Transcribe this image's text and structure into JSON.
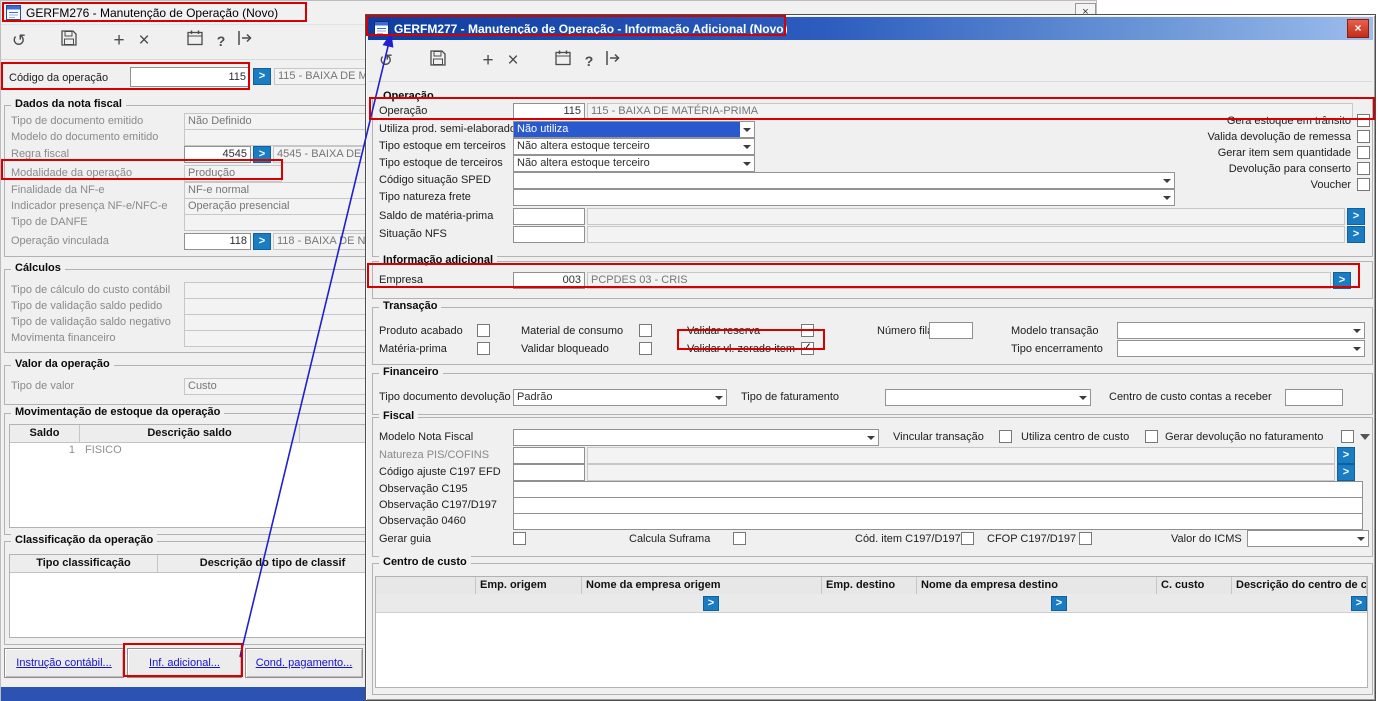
{
  "icons": {
    "undo": "↺",
    "add": "+",
    "delete": "×",
    "help": "?",
    "close": "×",
    "lookup": ">",
    "check": "✓"
  },
  "win1": {
    "title": "GERFM276 - Manutenção de Operação (Novo)",
    "codigo": {
      "label": "Código da operação",
      "value": "115",
      "desc": "115 - BAIXA DE M"
    },
    "dados": {
      "title": "Dados da nota fiscal",
      "rows": [
        {
          "label": "Tipo de documento emitido",
          "value": "Não Definido"
        },
        {
          "label": "Modelo do documento emitido",
          "value": ""
        },
        {
          "label": "Regra fiscal",
          "value": "4545",
          "desc": "4545 - BAIXA DE"
        },
        {
          "label": "Modalidade da operação",
          "value": "Produção"
        },
        {
          "label": "Finalidade da NF-e",
          "value": "NF-e normal"
        },
        {
          "label": "Indicador presença NF-e/NFC-e",
          "value": "Operação presencial"
        },
        {
          "label": "Tipo de DANFE",
          "value": ""
        },
        {
          "label": "Operação vinculada",
          "value": "118",
          "desc": "118 - BAIXA DE N"
        }
      ]
    },
    "calculos": {
      "title": "Cálculos",
      "rows": [
        {
          "label": "Tipo de cálculo do custo contábil",
          "value": ""
        },
        {
          "label": "Tipo de validação saldo pedido",
          "value": ""
        },
        {
          "label": "Tipo de validação saldo negativo",
          "value": ""
        },
        {
          "label": "Movimenta financeiro",
          "value": ""
        }
      ]
    },
    "valor": {
      "title": "Valor da operação",
      "rows": [
        {
          "label": "Tipo de valor",
          "value": "Custo"
        }
      ]
    },
    "mov_estoque": {
      "title": "Movimentação de estoque da operação",
      "headers": [
        "Saldo",
        "Descrição saldo"
      ],
      "rows": [
        {
          "saldo": "1",
          "desc": "FISICO"
        }
      ]
    },
    "classificacao": {
      "title": "Classificação da operação",
      "headers": [
        "Tipo classificação",
        "Descrição do tipo de classif"
      ]
    },
    "buttons": [
      {
        "label": "Instrução contábil..."
      },
      {
        "label": "Inf. adicional..."
      },
      {
        "label": "Cond. pagamento..."
      }
    ]
  },
  "win2": {
    "title": "GERFM277 - Manutenção de Operação - Informação Adicional (Novo)",
    "operacao": {
      "title": "Operação",
      "row": {
        "label": "Operação",
        "value": "115",
        "desc": "115 - BAIXA DE MATÉRIA-PRIMA"
      },
      "dropdowns": [
        {
          "label": "Utiliza prod. semi-elaborado",
          "value": "Não utiliza",
          "selected": true
        },
        {
          "label": "Tipo estoque em terceiros",
          "value": "Não altera estoque terceiro",
          "selected": false
        },
        {
          "label": "Tipo estoque de terceiros",
          "value": "Não altera estoque terceiro",
          "selected": false
        },
        {
          "label": "Código situação SPED",
          "value": "",
          "selected": false
        },
        {
          "label": "Tipo natureza frete",
          "value": "",
          "selected": false
        }
      ],
      "lookups": [
        {
          "label": "Saldo de matéria-prima",
          "value": "",
          "desc": ""
        },
        {
          "label": "Situação NFS",
          "value": "",
          "desc": ""
        }
      ],
      "checkboxes": [
        {
          "label": "Gera estoque em trânsito",
          "checked": false
        },
        {
          "label": "Valida devolução de remessa",
          "checked": false
        },
        {
          "label": "Gerar item sem quantidade",
          "checked": false
        },
        {
          "label": "Devolução para conserto",
          "checked": false
        },
        {
          "label": "Voucher",
          "checked": false
        }
      ]
    },
    "info_adicional": {
      "title": "Informação adicional",
      "empresa": {
        "label": "Empresa",
        "value": "003",
        "desc": "PCPDES 03 - CRIS"
      }
    },
    "transacao": {
      "title": "Transação",
      "checkboxes": [
        {
          "label": "Produto acabado",
          "checked": false
        },
        {
          "label": "Material de consumo",
          "checked": false
        },
        {
          "label": "Validar reserva",
          "checked": false
        },
        {
          "label": "Matéria-prima",
          "checked": false
        },
        {
          "label": "Validar bloqueado",
          "checked": false
        },
        {
          "label": "Validar vl. zerado item",
          "checked": true
        }
      ],
      "numero_fila": {
        "label": "Número fila",
        "value": ""
      },
      "modelo_transacao": {
        "label": "Modelo transação",
        "value": ""
      },
      "tipo_encerramento": {
        "label": "Tipo encerramento",
        "value": ""
      }
    },
    "financeiro": {
      "title": "Financeiro",
      "tipo_documento_devolucao": {
        "label": "Tipo documento devolução",
        "value": "Padrão"
      },
      "tipo_faturamento": {
        "label": "Tipo de faturamento",
        "value": ""
      },
      "centro_custo_receber": {
        "label": "Centro de custo contas a receber",
        "value": ""
      }
    },
    "fiscal": {
      "title": "Fiscal",
      "modelo_nota_fiscal": {
        "label": "Modelo Nota Fiscal",
        "value": ""
      },
      "checkboxes": [
        {
          "label": "Vincular transação",
          "checked": false
        },
        {
          "label": "Utiliza centro de custo",
          "checked": false
        },
        {
          "label": "Gerar devolução no faturamento",
          "checked": false
        },
        {
          "label": "Gerar guia",
          "checked": false
        },
        {
          "label": "Calcula Suframa",
          "checked": false
        },
        {
          "label": "Cód. item C197/D197",
          "checked": false
        },
        {
          "label": "CFOP C197/D197",
          "checked": false
        }
      ],
      "lookups": [
        {
          "label": "Natureza PIS/COFINS",
          "value": "",
          "desc": ""
        },
        {
          "label": "Código ajuste C197 EFD",
          "value": "",
          "desc": ""
        }
      ],
      "observacoes": [
        {
          "label": "Observação C195",
          "value": ""
        },
        {
          "label": "Observação C197/D197",
          "value": ""
        },
        {
          "label": "Observação 0460",
          "value": ""
        }
      ],
      "valor_icms": {
        "label": "Valor do ICMS",
        "value": ""
      }
    },
    "centro_custo": {
      "title": "Centro de custo",
      "headers": [
        "Emp. origem",
        "Nome da empresa origem",
        "Emp. destino",
        "Nome da empresa destino",
        "C. custo",
        "Descrição do centro de custo"
      ]
    }
  }
}
